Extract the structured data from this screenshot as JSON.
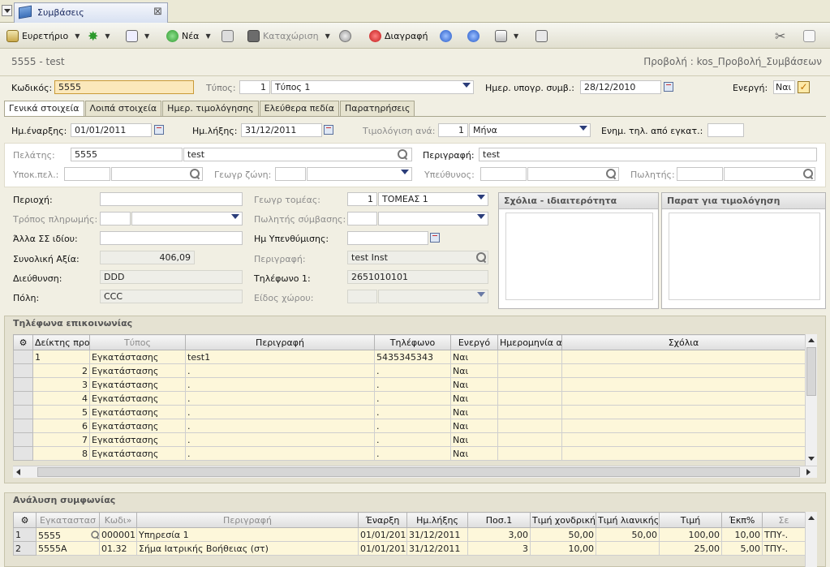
{
  "window": {
    "tab_title": "Συμβάσεις"
  },
  "toolbar": {
    "index": "Ευρετήριο",
    "new": "Νέα",
    "save": "Καταχώριση",
    "delete": "Διαγραφή"
  },
  "header": {
    "record": "5555 - test",
    "view": "Προβολή : kos_Προβολή_Συμβάσεων"
  },
  "top_fields": {
    "code_label": "Κωδικός:",
    "code_value": "5555",
    "type_label": "Τύπος:",
    "type_num": "1",
    "type_value": "Τύπος 1",
    "sign_date_label": "Ημερ. υπογρ. συμβ.:",
    "sign_date_value": "28/12/2010",
    "active_label": "Ενεργή:",
    "active_value": "Ναι"
  },
  "subtabs": [
    "Γενικά στοιχεία",
    "Λοιπά στοιχεία",
    "Ημερ. τιμολόγησης",
    "Ελεύθερα πεδία",
    "Παρατηρήσεις"
  ],
  "general": {
    "start_label": "Ημ.έναρξης:",
    "start_value": "01/01/2011",
    "end_label": "Ημ.λήξης:",
    "end_value": "31/12/2011",
    "billing_label": "Τιμολόγιση ανά:",
    "billing_num": "1",
    "billing_value": "Μήνα",
    "notify_label": "Ενημ. τηλ. από εγκατ.:",
    "customer_label": "Πελάτης:",
    "customer_code": "5555",
    "customer_name": "test",
    "desc_label": "Περιγραφή:",
    "desc_value": "test",
    "subcust_label": "Υποκ.πελ.:",
    "geo_zone_label": "Γεωγρ ζώνη:",
    "responsible_label": "Υπεύθυνος:",
    "seller_label": "Πωλητής:",
    "area_label": "Περιοχή:",
    "geo_sector_label": "Γεωγρ τομέας:",
    "geo_sector_num": "1",
    "geo_sector_value": "ΤΟΜΕΑΣ 1",
    "payment_label": "Τρόπος πληρωμής:",
    "contract_seller_label": "Πωλητής σύμβασης:",
    "other_label": "Άλλα ΣΣ ιδίου:",
    "reminder_label": "Ημ Υπενθύμισης:",
    "total_label": "Συνολική Αξία:",
    "total_value": "406,09",
    "inst_desc_label": "Περιγραφή:",
    "inst_desc_value": "test Inst",
    "address_label": "Διεύθυνση:",
    "address_value": "DDD",
    "phone_label": "Τηλέφωνο 1:",
    "phone_value": "2651010101",
    "city_label": "Πόλη:",
    "city_value": "CCC",
    "space_type_label": "Είδος χώρου:",
    "comments_title": "Σχόλια - ιδιαιτερότητα",
    "billing_notes_title": "Παρατ για τιμολόγηση"
  },
  "phones": {
    "title": "Τηλέφωνα επικοινωνίας",
    "columns": [
      "Δείκτης προτ",
      "Τύπος",
      "Περιγραφή",
      "Τηλέφωνο",
      "Ενεργό",
      "Ημερομηνία απ",
      "Σχόλια"
    ],
    "rows": [
      [
        "1",
        "Εγκατάστασης",
        "test1",
        "5435345343",
        "Ναι"
      ],
      [
        "2",
        "Εγκατάστασης",
        ".",
        ".",
        "Ναι"
      ],
      [
        "3",
        "Εγκατάστασης",
        ".",
        ".",
        "Ναι"
      ],
      [
        "4",
        "Εγκατάστασης",
        ".",
        ".",
        "Ναι"
      ],
      [
        "5",
        "Εγκατάστασης",
        ".",
        ".",
        "Ναι"
      ],
      [
        "6",
        "Εγκατάστασης",
        ".",
        ".",
        "Ναι"
      ],
      [
        "7",
        "Εγκατάστασης",
        ".",
        ".",
        "Ναι"
      ],
      [
        "8",
        "Εγκατάστασης",
        ".",
        ".",
        "Ναι"
      ]
    ]
  },
  "analysis": {
    "title": "Ανάλυση συμφωνίας",
    "columns": [
      "Εγκαταστασ",
      "Κωδι»",
      "Περιγραφή",
      "Έναρξη",
      "Ημ.λήξης",
      "Ποσ.1",
      "Τιμή χονδρική",
      "Τιμή λιανικής",
      "Τιμή",
      "Έκπ%",
      "Σε"
    ],
    "rows": [
      [
        "1",
        "5555",
        "000001",
        "Υπηρεσία 1",
        "01/01/2011",
        "31/12/2011",
        "3,00",
        "50,00",
        "50,00",
        "100,00",
        "10,00",
        "ΤΠΥ-."
      ],
      [
        "2",
        "5555A",
        "01.32",
        "Σήμα Ιατρικής Βοήθειας (στ)",
        "01/01/2011",
        "31/12/2011",
        "3",
        "10,00",
        "",
        "25,00",
        "5,00",
        "ΤΠΥ-."
      ]
    ]
  }
}
